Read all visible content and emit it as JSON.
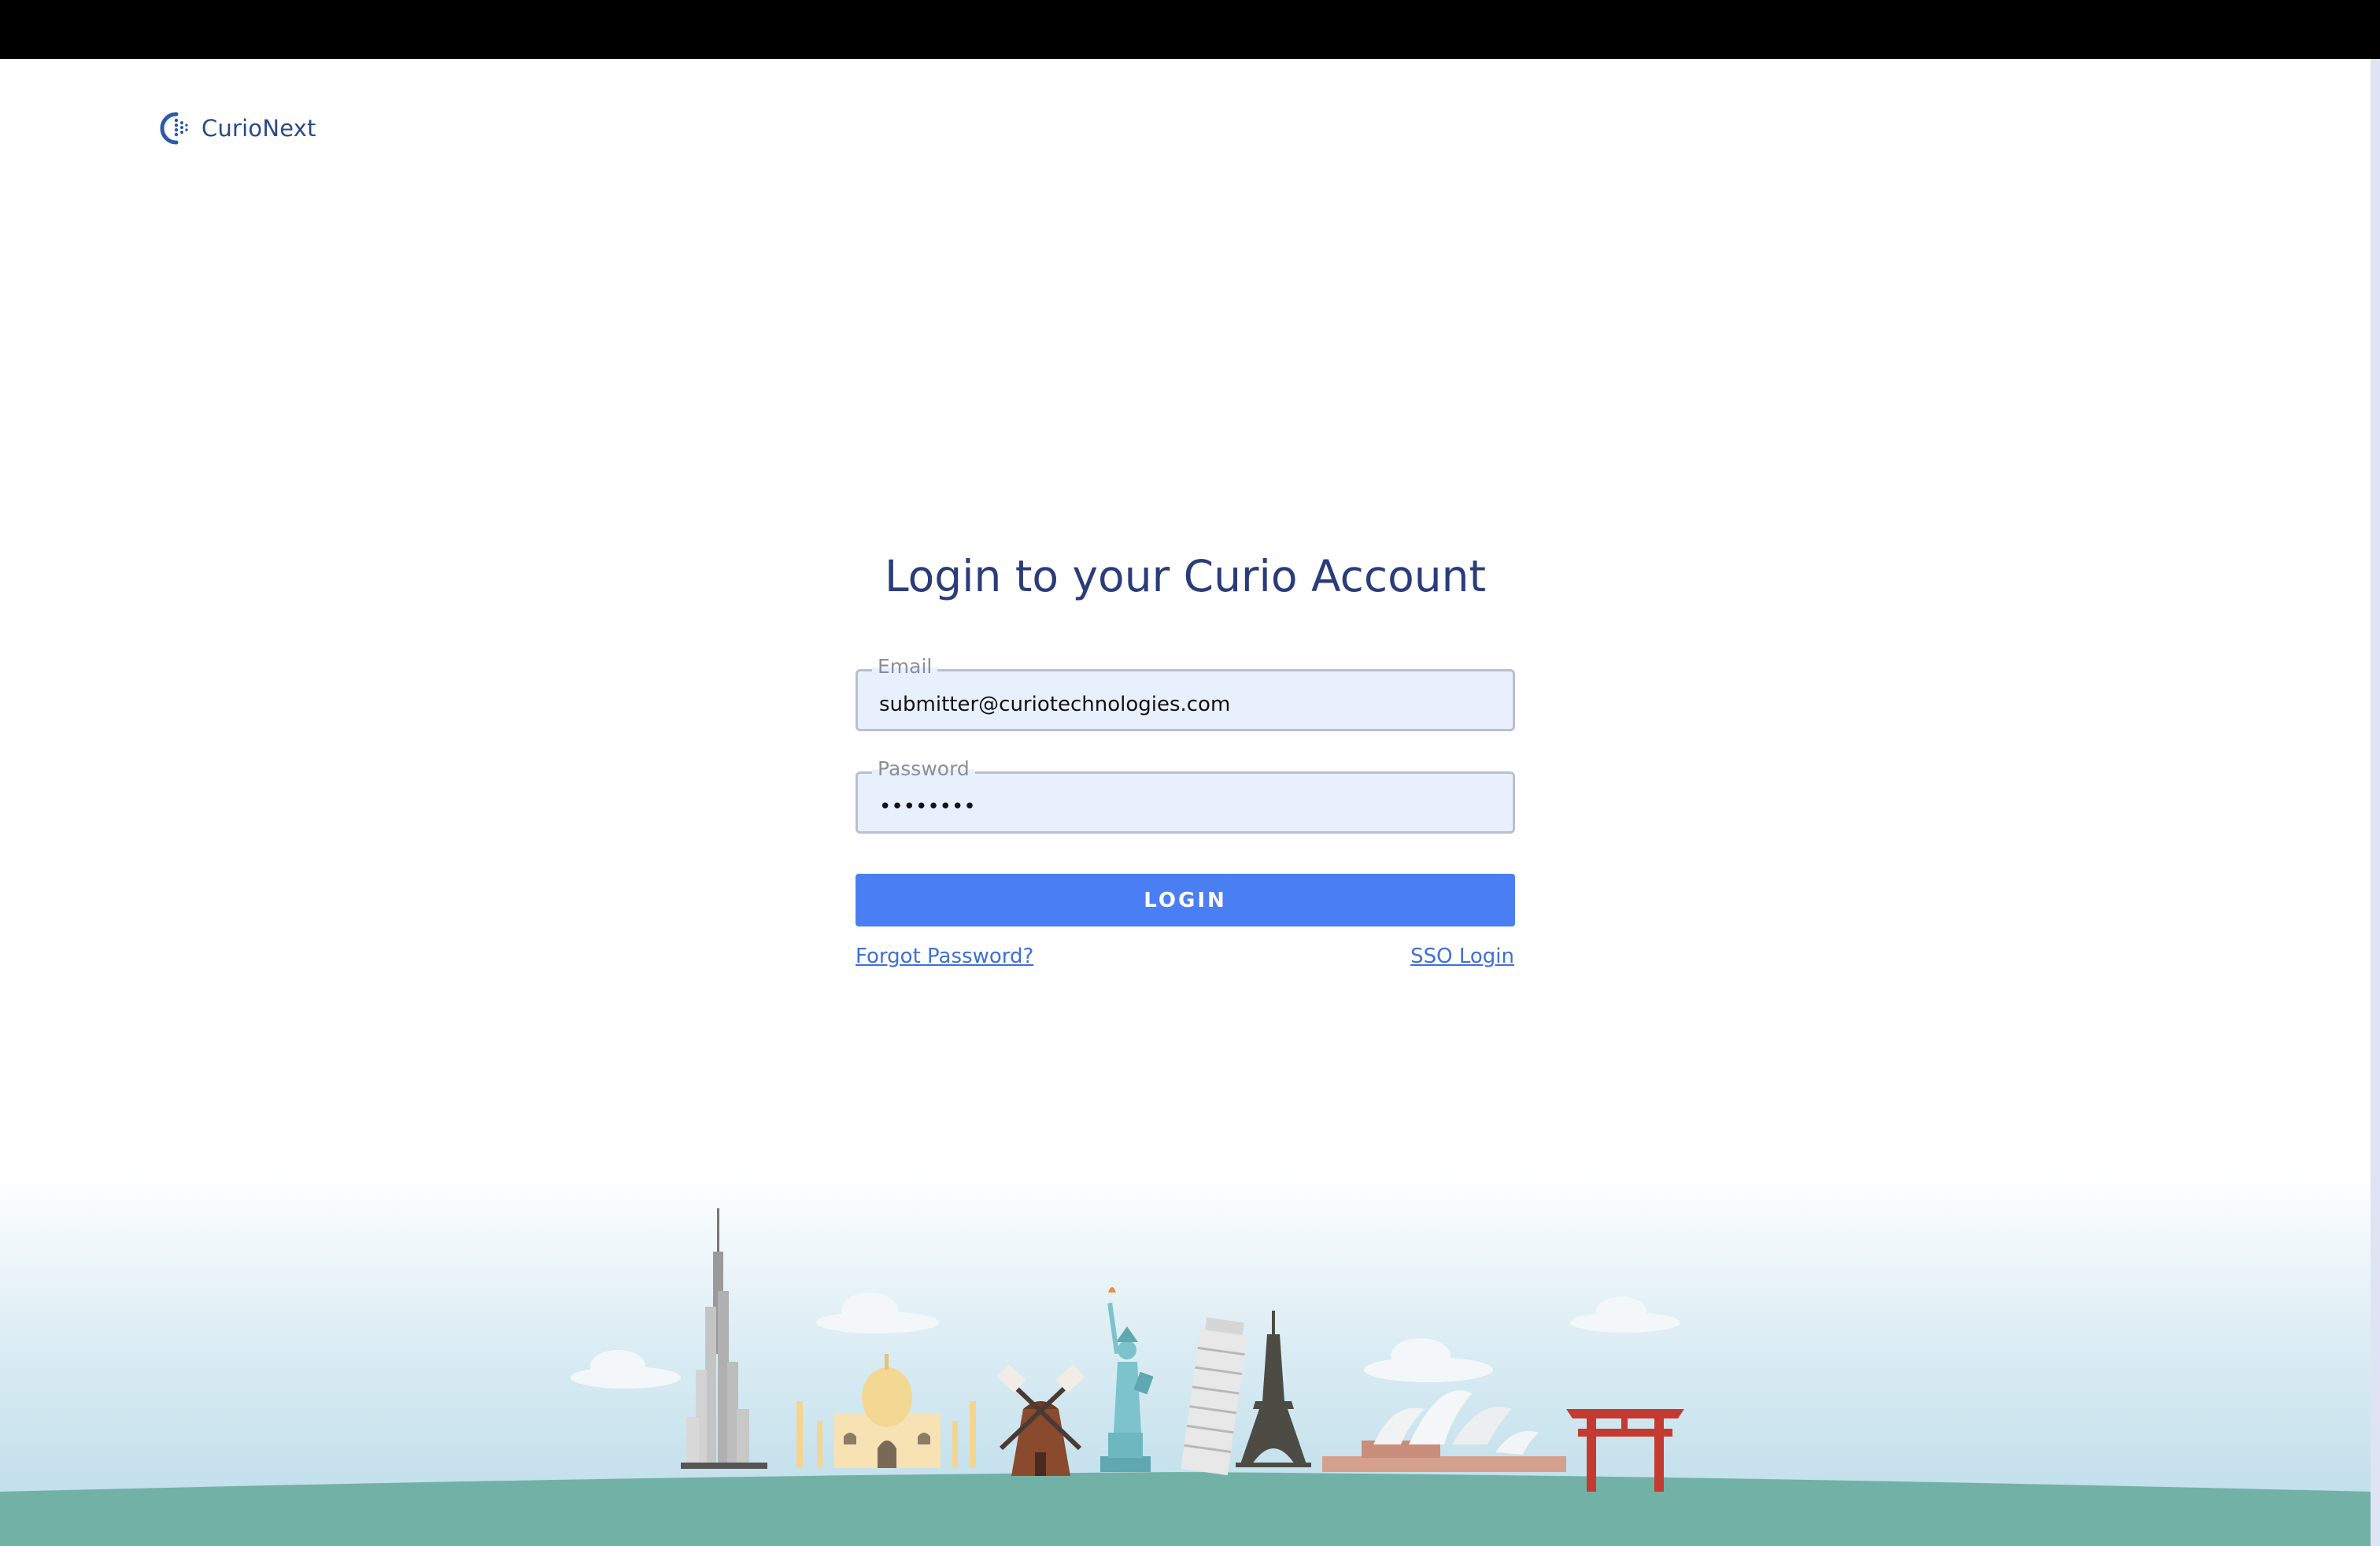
{
  "brand": {
    "name": "CurioNext"
  },
  "login": {
    "title": "Login to your Curio Account",
    "email": {
      "label": "Email",
      "value": "submitter@curiotechnologies.com"
    },
    "password": {
      "label": "Password",
      "value": "••••••••"
    },
    "submit_label": "LOGIN",
    "forgot_label": "Forgot Password?",
    "sso_label": "SSO Login"
  },
  "colors": {
    "primary": "#4a7ff4",
    "title": "#2b3c7a",
    "input_bg": "#e8f0fe",
    "ground": "#72b2a6",
    "topbar": "#000000"
  }
}
